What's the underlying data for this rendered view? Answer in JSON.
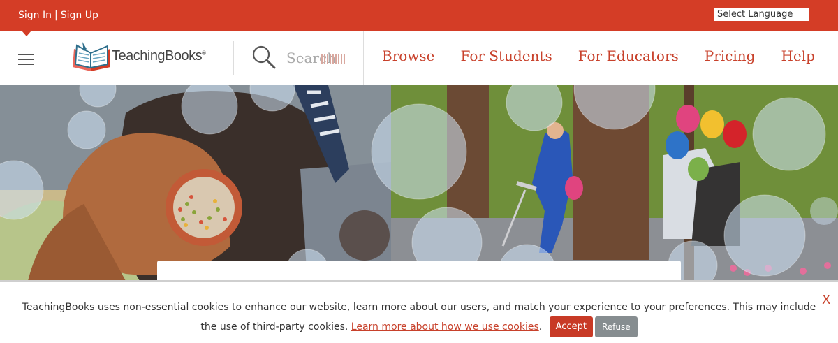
{
  "topbar": {
    "sign_in": "Sign In",
    "separator": "|",
    "sign_up": "Sign Up",
    "language": "Select Language"
  },
  "header": {
    "logo_text": "TeachingBooks",
    "logo_mark": "®",
    "search_placeholder": "Search"
  },
  "nav": {
    "links": [
      "Browse",
      "For Students",
      "For Educators",
      "Pricing",
      "Help"
    ]
  },
  "cookie": {
    "text": "TeachingBooks uses non-essential cookies to enhance our website, learn more about our users, and match your experience to your preferences. This may include the use of third-party cookies.",
    "link": "Learn more about how we use cookies",
    "period": ".",
    "accept": "Accept",
    "refuse": "Refuse",
    "close": "X"
  },
  "colors": {
    "brand_red": "#d43d26",
    "link_red": "#c8412b",
    "refuse_gray": "#868d90"
  },
  "icons": [
    "menu-icon",
    "open-book-logo-icon",
    "search-icon",
    "close-icon"
  ]
}
